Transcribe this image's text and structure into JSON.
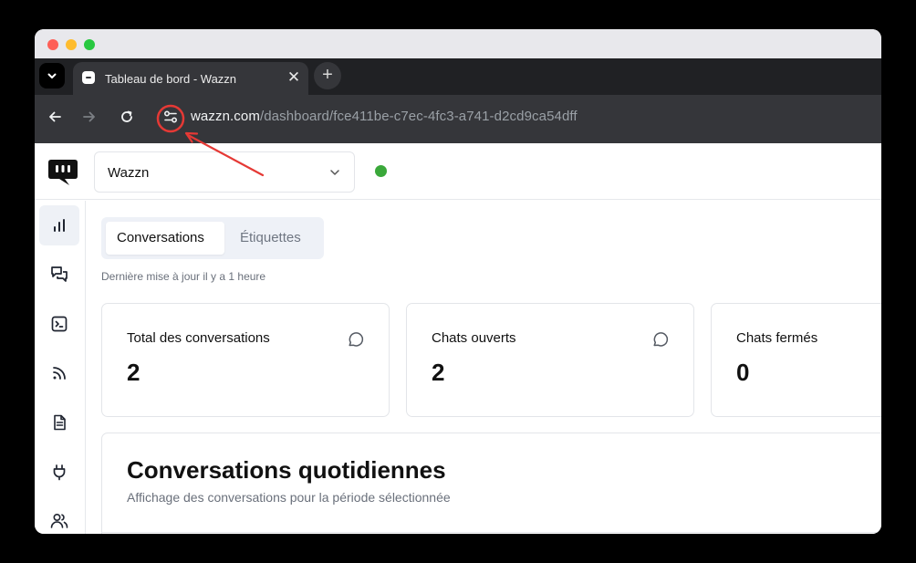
{
  "browser": {
    "tab_title": "Tableau de bord - Wazzn",
    "tab_close": "✕",
    "new_tab": "+",
    "url_host": "wazzn.com",
    "url_path": "/dashboard/fce411be-c7ec-4fc3-a741-d2cd9ca54dff"
  },
  "topbar": {
    "workspace_name": "Wazzn",
    "status_color": "#3aa83a"
  },
  "sidebar": {
    "items": [
      {
        "icon": "bar-chart-icon",
        "active": true
      },
      {
        "icon": "conversations-icon"
      },
      {
        "icon": "terminal-icon"
      },
      {
        "icon": "rss-icon"
      },
      {
        "icon": "document-icon"
      },
      {
        "icon": "plug-icon"
      },
      {
        "icon": "users-icon"
      }
    ]
  },
  "main": {
    "tabs": [
      {
        "label": "Conversations",
        "selected": true
      },
      {
        "label": "Étiquettes",
        "selected": false
      }
    ],
    "last_updated": "Dernière mise à jour il y a 1 heure",
    "cards": [
      {
        "title": "Total des conversations",
        "value": "2",
        "icon": "chat-bubble-icon"
      },
      {
        "title": "Chats ouverts",
        "value": "2",
        "icon": "chat-bubble-icon"
      },
      {
        "title": "Chats fermés",
        "value": "0"
      }
    ],
    "daily": {
      "title": "Conversations quotidiennes",
      "subtitle": "Affichage des conversations pour la période sélectionnée"
    }
  },
  "annotation": {
    "color": "#e53935"
  }
}
